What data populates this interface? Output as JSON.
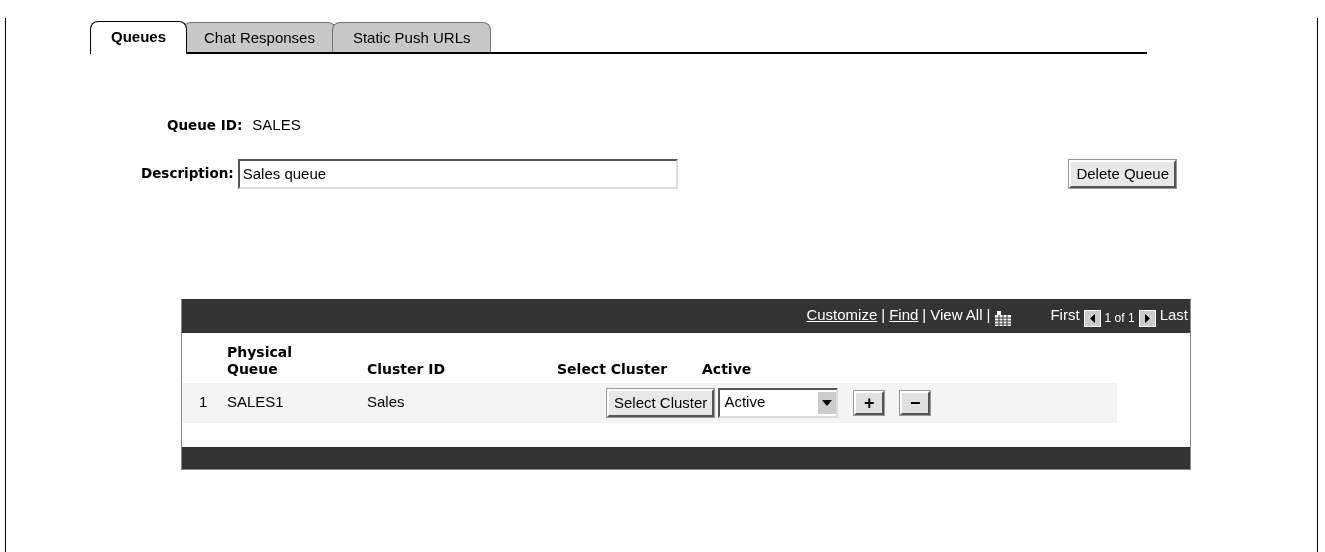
{
  "tabs": [
    {
      "label": "Queues",
      "selected": true
    },
    {
      "label": "Chat Responses",
      "selected": false
    },
    {
      "label": "Static Push URLs",
      "selected": false
    }
  ],
  "queue_id": {
    "label": "Queue ID:",
    "value": "SALES"
  },
  "description": {
    "label": "Description:",
    "value": "Sales queue"
  },
  "delete_button": "Delete Queue",
  "grid": {
    "toolbar": [
      {
        "kind": "link",
        "text": "Customize"
      },
      {
        "kind": "sep",
        "text": "|"
      },
      {
        "kind": "link",
        "text": "Find"
      },
      {
        "kind": "sep",
        "text": "|"
      },
      {
        "kind": "text",
        "text": "View All"
      },
      {
        "kind": "sep",
        "text": "|"
      },
      {
        "kind": "grid-icon"
      },
      {
        "kind": "gap"
      },
      {
        "kind": "text",
        "text": "First"
      },
      {
        "kind": "prev-icon"
      },
      {
        "kind": "count",
        "text": "1 of 1"
      },
      {
        "kind": "next-icon"
      },
      {
        "kind": "text",
        "text": "Last"
      }
    ],
    "columns": [
      "Physical Queue",
      "Cluster ID",
      "Select Cluster",
      "Active"
    ],
    "rows": [
      {
        "number": "1",
        "physical_queue": "SALES1",
        "cluster_id": "Sales",
        "button": "Select Cluster",
        "status": "Active",
        "add": "+",
        "remove": "−"
      }
    ]
  }
}
